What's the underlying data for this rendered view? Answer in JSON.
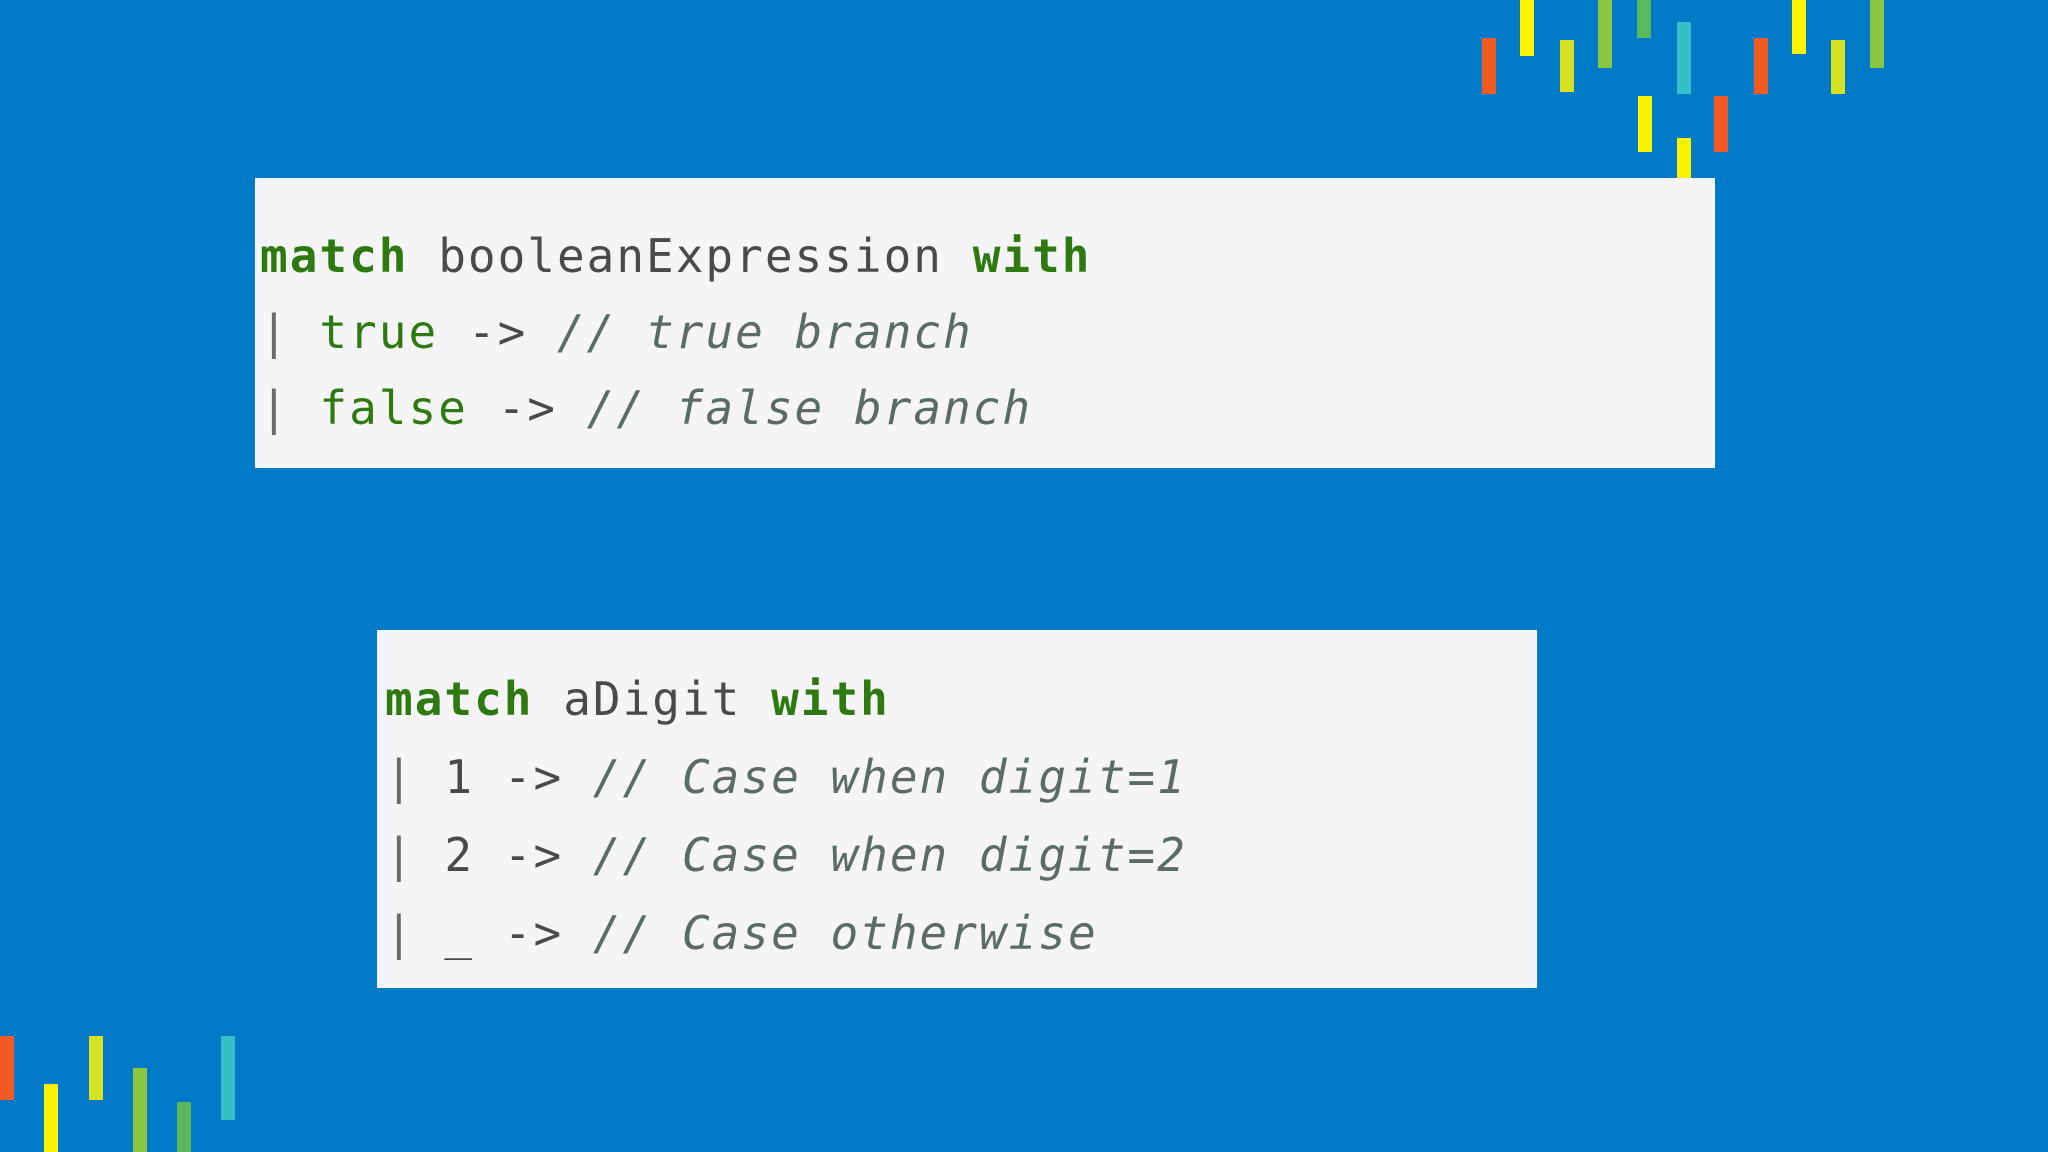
{
  "palette": {
    "background": "#0079c6",
    "panel": "#f5f5f7",
    "keyword": "#2e7a11",
    "comment": "#5d6b66",
    "plain": "#4a4a4a"
  },
  "block1": {
    "line1": {
      "kw_match": "match",
      "expr": "booleanExpression",
      "kw_with": "with"
    },
    "line2": {
      "pipe": "|",
      "pattern": "true",
      "arrow": "->",
      "comment": "// true branch"
    },
    "line3": {
      "pipe": "|",
      "pattern": "false",
      "arrow": "->",
      "comment": "// false branch"
    }
  },
  "block2": {
    "line1": {
      "kw_match": "match",
      "expr": "aDigit",
      "kw_with": "with"
    },
    "line2": {
      "pipe": "|",
      "pattern": "1",
      "arrow": "->",
      "comment": "// Case when digit=1"
    },
    "line3": {
      "pipe": "|",
      "pattern": "2",
      "arrow": "->",
      "comment": "// Case when digit=2"
    },
    "line4": {
      "pipe": "|",
      "pattern": "_",
      "arrow": "->",
      "comment": "// Case otherwise"
    }
  }
}
